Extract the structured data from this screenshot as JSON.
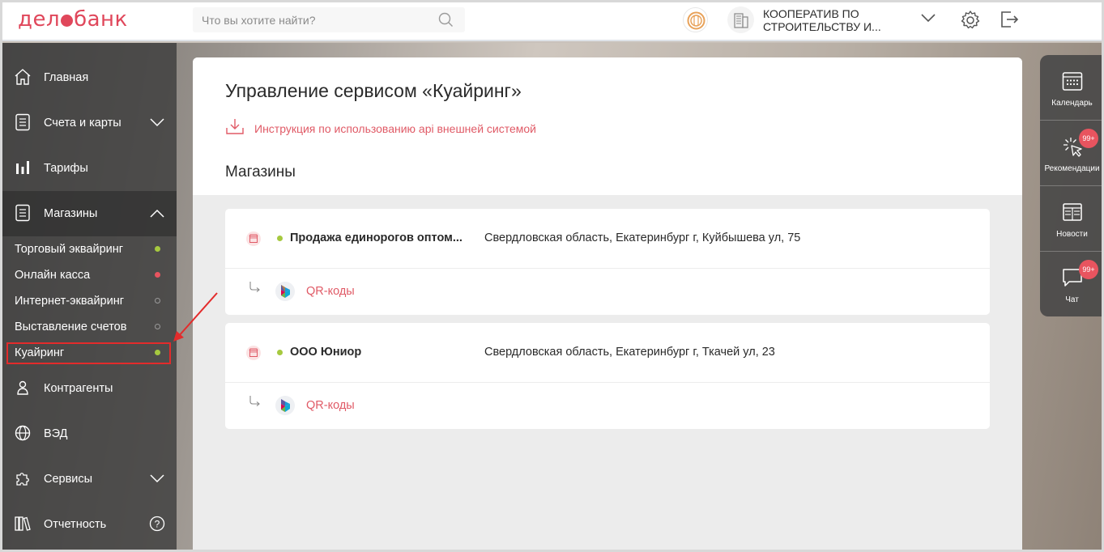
{
  "header": {
    "logo": {
      "left": "дел",
      "right": "банк"
    },
    "search_placeholder": "Что вы хотите найти?",
    "org_name_line1": "КООПЕРАТИВ ПО",
    "org_name_line2": "СТРОИТЕЛЬСТВУ И..."
  },
  "sidebar": {
    "items": [
      {
        "label": "Главная",
        "icon": "home-icon"
      },
      {
        "label": "Счета и карты",
        "icon": "document-icon",
        "chevron": "down"
      },
      {
        "label": "Тарифы",
        "icon": "bar-chart-icon"
      },
      {
        "label": "Магазины",
        "icon": "document-icon",
        "chevron": "up"
      },
      {
        "label": "Контрагенты",
        "icon": "person-icon"
      },
      {
        "label": "ВЭД",
        "icon": "globe-icon"
      },
      {
        "label": "Сервисы",
        "icon": "puzzle-icon",
        "chevron": "down"
      },
      {
        "label": "Отчетность",
        "icon": "books-icon"
      }
    ],
    "subitems": [
      {
        "label": "Торговый эквайринг",
        "status": "green"
      },
      {
        "label": "Онлайн касса",
        "status": "red"
      },
      {
        "label": "Интернет-эквайринг",
        "status": "empty"
      },
      {
        "label": "Выставление счетов",
        "status": "empty"
      },
      {
        "label": "Куайринг",
        "status": "green"
      }
    ],
    "help": "?"
  },
  "main": {
    "title": "Управление сервисом «Куайринг»",
    "instruction_link": "Инструкция по использованию api внешней системой",
    "section_title": "Магазины",
    "stores": [
      {
        "name": "Продажа единорогов оптом...",
        "address": "Свердловская область, Екатеринбург г, Куйбышева ул, 75",
        "qr_label": "QR-коды"
      },
      {
        "name": "ООО Юниор",
        "address": "Свердловская область, Екатеринбург г, Ткачей ул, 23",
        "qr_label": "QR-коды"
      }
    ]
  },
  "right_panel": {
    "items": [
      {
        "label": "Календарь",
        "icon": "calendar-icon"
      },
      {
        "label": "Рекомендации",
        "icon": "sparkle-cursor-icon",
        "badge": "99+"
      },
      {
        "label": "Новости",
        "icon": "newspaper-icon"
      },
      {
        "label": "Чат",
        "icon": "chat-icon",
        "badge": "99+"
      }
    ]
  },
  "colors": {
    "brand": "#e0475b",
    "link": "#e05a66",
    "status_green": "#a6c93f",
    "status_red": "#e8545f",
    "highlight": "#e32b2b"
  }
}
